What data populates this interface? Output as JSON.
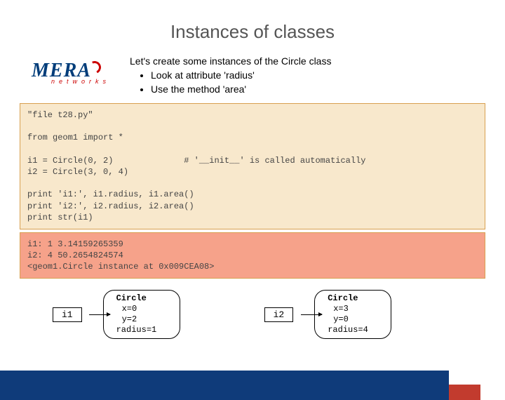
{
  "logo": {
    "main": "MERA",
    "sub": "networks"
  },
  "title": "Instances of classes",
  "bullets": {
    "main": "Let's create some instances of the Circle class",
    "sub": [
      "Look at attribute 'radius'",
      "Use the method 'area'"
    ]
  },
  "code": {
    "source": "\"file t28.py\"\n\nfrom geom1 import *\n\ni1 = Circle(0, 2)              # '__init__' is called automatically\ni2 = Circle(3, 0, 4)\n\nprint 'i1:', i1.radius, i1.area()\nprint 'i2:', i2.radius, i2.area()\nprint str(i1)",
    "output": "i1: 1 3.14159265359\ni2: 4 50.2654824574\n<geom1.Circle instance at 0x009CEA08>"
  },
  "diagram": {
    "objects": [
      {
        "var": "i1",
        "cls": "Circle",
        "x": "x=0",
        "y": "y=2",
        "r": "radius=1"
      },
      {
        "var": "i2",
        "cls": "Circle",
        "x": "x=3",
        "y": "y=0",
        "r": "radius=4"
      }
    ]
  }
}
